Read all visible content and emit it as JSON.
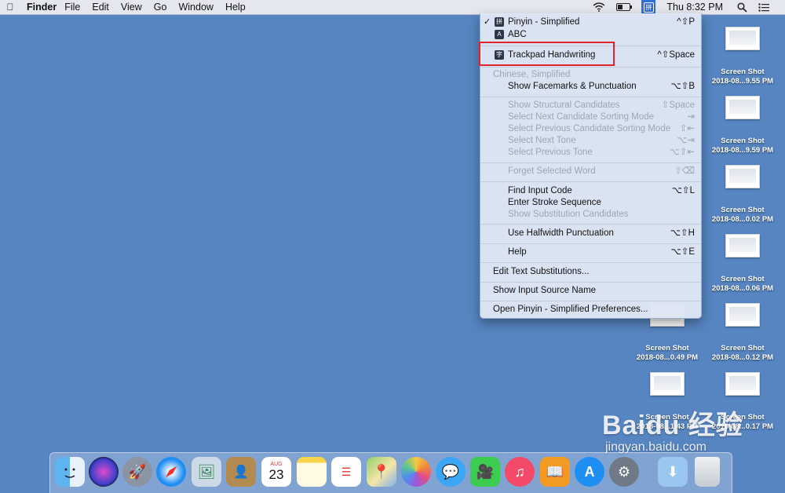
{
  "menubar": {
    "app_name": "Finder",
    "items": [
      "File",
      "Edit",
      "View",
      "Go",
      "Window",
      "Help"
    ],
    "input_source_icon": "拼",
    "clock": "Thu 8:32 PM"
  },
  "input_menu": {
    "sources": [
      {
        "icon": "拼",
        "label": "Pinyin - Simplified",
        "shortcut": "^⇧P",
        "checked": true
      },
      {
        "icon": "A",
        "label": "ABC",
        "shortcut": ""
      }
    ],
    "handwriting": {
      "icon": "字",
      "label": "Trackpad Handwriting",
      "shortcut": "^⇧Space"
    },
    "section_header": "Chinese, Simplified",
    "facemarks": {
      "label": "Show Facemarks & Punctuation",
      "shortcut": "⌥⇧B"
    },
    "candidates": [
      {
        "label": "Show Structural Candidates",
        "shortcut": "⇧Space"
      },
      {
        "label": "Select Next Candidate Sorting Mode",
        "shortcut": "⇥"
      },
      {
        "label": "Select Previous Candidate Sorting Mode",
        "shortcut": "⇧⇤"
      },
      {
        "label": "Select Next Tone",
        "shortcut": "⌥⇥"
      },
      {
        "label": "Select Previous Tone",
        "shortcut": "⌥⇧⇤"
      }
    ],
    "forget": {
      "label": "Forget Selected Word",
      "shortcut": "⇧⌫"
    },
    "find_input_code": {
      "label": "Find Input Code",
      "shortcut": "⌥⇧L"
    },
    "enter_stroke": {
      "label": "Enter Stroke Sequence",
      "shortcut": ""
    },
    "show_substitution": {
      "label": "Show Substitution Candidates",
      "shortcut": ""
    },
    "halfwidth": {
      "label": "Use Halfwidth Punctuation",
      "shortcut": "⌥⇧H"
    },
    "help": {
      "label": "Help",
      "shortcut": "⌥⇧E"
    },
    "edit_text_subs": "Edit Text Substitutions...",
    "show_source_name": "Show Input Source Name",
    "open_prefs": "Open Pinyin - Simplified Preferences..."
  },
  "desktop_icons": [
    {
      "line1": "Screen Shot",
      "line2": "2018-08...9.55 PM"
    },
    {
      "line1": "Screen Shot",
      "line2": "2018-08...9.59 PM"
    },
    {
      "line1": "Screen Shot",
      "line2": "2018-08...0.02 PM"
    },
    {
      "line1": "Screen Shot",
      "line2": "2018-08...0.06 PM"
    },
    {
      "line1": "Screen Shot",
      "line2": "2018-08...0.12 PM"
    },
    {
      "line1": "Screen Shot",
      "line2": "2018-08...0.17 PM"
    },
    {
      "line1": "Screen Shot",
      "line2": "2018-08...0.49 PM"
    },
    {
      "line1": "Screen Shot",
      "line2": "2018-08...1.43 PM"
    }
  ],
  "dock": {
    "calendar_month": "AUG",
    "calendar_day": "23"
  },
  "watermark": {
    "line1": "Baidu 经验",
    "line2": "jingyan.baidu.com"
  },
  "colors": {
    "desktop": "#5785c1",
    "highlight_box": "#e0242b",
    "menubar_selected": "#2f6fd8"
  }
}
